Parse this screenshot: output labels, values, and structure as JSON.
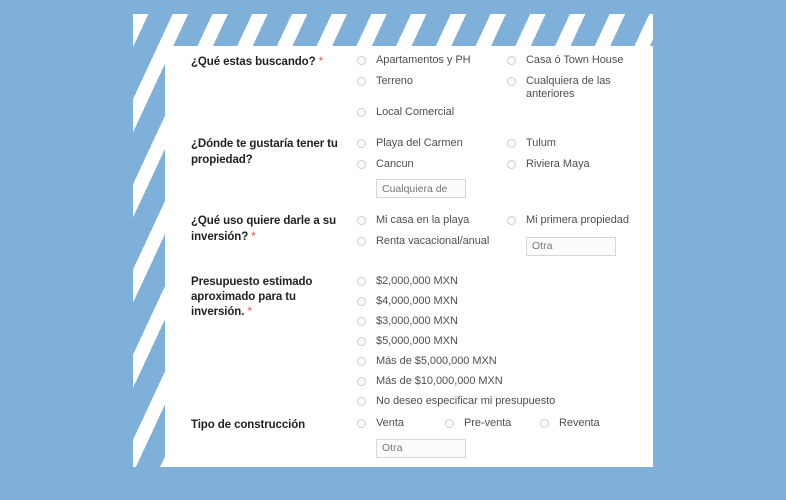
{
  "form": {
    "questions": [
      {
        "id": "que-estas-buscando",
        "label": "¿Qué estas buscando?",
        "required_mark": "*",
        "required": true,
        "column_a": [
          "Apartamentos y PH",
          "Terreno",
          "Local Comercial"
        ],
        "column_b": [
          "Casa ó Town House",
          "Cualquiera de las anteriores"
        ]
      },
      {
        "id": "donde-te-gustaria",
        "label": "¿Dónde te gustaría tener tu propiedad?",
        "required_mark": "",
        "required": false,
        "column_a": [
          "Playa del Carmen",
          "Cancun"
        ],
        "column_b": [
          "Tulum",
          "Riviera Maya"
        ],
        "other_input": {
          "name": "otra-ubicacion-input",
          "value": "",
          "placeholder": "Cualquiera de"
        }
      },
      {
        "id": "que-uso",
        "label": "¿Qué uso quiere darle a su inversión?",
        "required_mark": "*",
        "required": true,
        "column_a": [
          "Mi casa en la playa",
          "Renta vacacional/anual"
        ],
        "column_b": [
          "Mi primera propiedad"
        ],
        "other_input": {
          "name": "otra-uso-input",
          "value": "",
          "placeholder": "Otra"
        }
      },
      {
        "id": "presupuesto",
        "label": "Presupuesto estimado aproximado para tu inversión.",
        "required_mark": "*",
        "required": true,
        "column_a": [
          "$2,000,000 MXN",
          "$4,000,000 MXN",
          "$3,000,000 MXN",
          "$5,000,000 MXN",
          "Más de $5,000,000 MXN",
          "Más de $10,000,000 MXN",
          "No deseo especificar mi presupuesto"
        ]
      },
      {
        "id": "tipo-de-construccion",
        "label": "Tipo de construcción",
        "required_mark": "",
        "required": false,
        "column_a": [
          "Venta"
        ],
        "column_b": [
          "Pre-venta"
        ],
        "column_c": [
          "Reventa"
        ],
        "other_input": {
          "name": "otra-construccion-input",
          "value": "",
          "placeholder": "Otra"
        }
      }
    ]
  },
  "theme": {
    "background": "#7fb0da",
    "card": "#ffffff",
    "stripe": "#7fb0da",
    "label_color": "#222222",
    "option_color": "#4f4f4f",
    "required_color": "#e8584f",
    "input_border": "#d6d6d6",
    "radio_border": "#cfcfcf"
  }
}
